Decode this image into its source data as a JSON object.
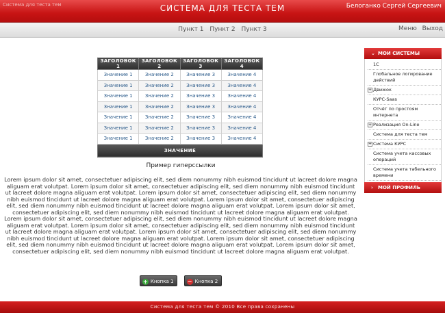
{
  "header": {
    "site_small": "Система для теста тем",
    "title": "СИСТЕМА ДЛЯ ТЕСТА ТЕМ",
    "user": "Белоганко Сергей Сергеевич"
  },
  "menu": {
    "items": [
      "Пункт 1",
      "Пункт 2",
      "Пункт 3"
    ],
    "right": [
      "Меню",
      "Выход"
    ]
  },
  "table": {
    "headers": [
      "Заголовок 1",
      "Заголовок 2",
      "Заголовок 3",
      "Заголовок 4"
    ],
    "rows": [
      [
        "Значение 1",
        "Значение 2",
        "Значение 3",
        "Значение 4"
      ],
      [
        "Значение 1",
        "Значение 2",
        "Значение 3",
        "Значение 4"
      ],
      [
        "Значение 1",
        "Значение 2",
        "Значение 3",
        "Значение 4"
      ],
      [
        "Значение 1",
        "Значение 2",
        "Значение 3",
        "Значение 4"
      ],
      [
        "Значение 1",
        "Значение 2",
        "Значение 3",
        "Значение 4"
      ],
      [
        "Значение 1",
        "Значение 2",
        "Значение 3",
        "Значение 4"
      ],
      [
        "Значение 1",
        "Значение 2",
        "Значение 3",
        "Значение 4"
      ]
    ],
    "footer": "Значение"
  },
  "hyperlink": "Пример гиперссылки",
  "lorem": "Lorem ipsum dolor sit amet, consectetuer adipiscing elit, sed diem nonummy nibh euismod tincidunt ut lacreet dolore magna aliguam erat volutpat. Lorem ipsum dolor sit amet, consectetuer adipiscing elit, sed diem nonummy nibh euismod tincidunt ut lacreet dolore magna aliguam erat volutpat. Lorem ipsum dolor sit amet, consectetuer adipiscing elit, sed diem nonummy nibh euismod tincidunt ut lacreet dolore magna aliguam erat volutpat. Lorem ipsum dolor sit amet, consectetuer adipiscing elit, sed diem nonummy nibh euismod tincidunt ut lacreet dolore magna aliguam erat volutpat. Lorem ipsum dolor sit amet, consectetuer adipiscing elit, sed diem nonummy nibh euismod tincidunt ut lacreet dolore magna aliguam erat volutpat. Lorem ipsum dolor sit amet, consectetuer adipiscing elit, sed diem nonummy nibh euismod tincidunt ut lacreet dolore magna aliguam erat volutpat. Lorem ipsum dolor sit amet, consectetuer adipiscing elit, sed diem nonummy nibh euismod tincidunt ut lacreet dolore magna aliguam erat volutpat. Lorem ipsum dolor sit amet, consectetuer adipiscing elit, sed diem nonummy nibh euismod tincidunt ut lacreet dolore magna aliguam erat volutpat. Lorem ipsum dolor sit amet, consectetuer adipiscing elit, sed diem nonummy nibh euismod tincidunt ut lacreet dolore magna aliguam erat volutpat. Lorem ipsum dolor sit amet, consectetuer adipiscing elit, sed diem nonummy nibh euismod tincidunt ut lacreet dolore magna aliguam erat volutpat.",
  "buttons": {
    "button1": "Кнопка 1",
    "button2": "Кнопка 2"
  },
  "sidebar": {
    "section1": "Мои системы",
    "items": [
      {
        "label": "1С",
        "group": false
      },
      {
        "label": "Глобальное логирование действий",
        "group": false
      },
      {
        "label": "Движок",
        "group": true
      },
      {
        "label": "КУРС-Saas",
        "group": false
      },
      {
        "label": "Отчёт по простоям интернета",
        "group": false
      },
      {
        "label": "Реализация On-Line",
        "group": true
      },
      {
        "label": "Система для теста тем",
        "group": false
      },
      {
        "label": "Система КУРС",
        "group": true
      },
      {
        "label": "Система учета кассовых операций",
        "group": false
      },
      {
        "label": "Система учета табельного времени",
        "group": false
      }
    ],
    "section2": "Мой профиль"
  },
  "footer": "Система для теста тем © 2010 Все права сохранены"
}
